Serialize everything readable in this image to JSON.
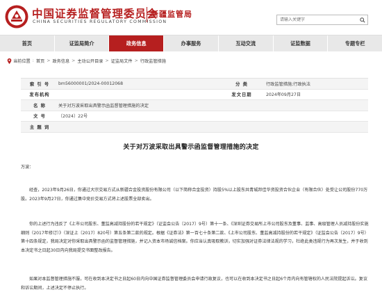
{
  "header": {
    "org_name": "中国证券监督管理委员会",
    "org_name_en": "CHINA SECURITIES REGULATORY COMMISSION",
    "bureau": "新疆监管局",
    "search_placeholder": "请输入关键字",
    "brand_color": "#b61f1f"
  },
  "nav": {
    "items": [
      {
        "label": "首页",
        "active": false
      },
      {
        "label": "证监局简介",
        "active": false
      },
      {
        "label": "政务信息",
        "active": true
      },
      {
        "label": "办事服务",
        "active": false
      },
      {
        "label": "互动交流",
        "active": false
      },
      {
        "label": "证监数据",
        "active": false
      },
      {
        "label": "专题专栏",
        "active": false
      }
    ]
  },
  "breadcrumb": {
    "items": [
      "当前位置",
      "首页",
      "政务信息",
      "主动公开目录",
      "证监局文件",
      "行政监管措施"
    ]
  },
  "info": {
    "index_label": "索 引 号",
    "index_value": "bm56000001/2024-00012068",
    "category_label": "分 类",
    "category_value": "行政监管措施;行政执法",
    "issuer_label": "发布机构",
    "issuer_value": "",
    "date_label": "发文日期",
    "date_value": "2024年09月27日",
    "name_label": "名 称",
    "name_value": "关于对万波采取出具警示函监督管理措施的决定",
    "doc_no_label": "文 号",
    "doc_no_value": "〔2024〕22号",
    "subject_label": "主 题 词",
    "subject_value": ""
  },
  "article": {
    "title": "关于对万波采取出具警示函监督管理措施的决定",
    "salutation": "万波：",
    "p1": "经查，2023年9月26日，你通过大宗交易方式从新疆合金投资股份有限公司（以下简称合金投资）持股5%以上股东共青城邦佳华资投资合伙企业（有限合伙）处受让公司股份770万股。2023年9月27日，你通过集中竞价交易方式将上述股票全部卖出。",
    "p2": "你的上述行为违反了《上市公司股东、董监高减持股份的若干规定》（证监会公告〔2017〕9号）第十一条、《深圳证券交易所上市公司股东及董事、监事、高级管理人员减持股份实施细则（2017年修订）》（深证上〔2017〕820号）第五条第二款的规定。根据《证券法》第一百七十条第二款、《上市公司股东、董监高减持股份的若干规定》（证监会公告〔2017〕9号）第十四条规定，我局决定对你采取出具警示函的监督管理措施，并记入资本市场诚信档案。你应当认真吸取教训，切实加强对证券法律法规的学习，杜绝此类违规行为再次发生，并于收到本决定书之日起30日内向我局提交书面整改报告。",
    "p3": "如果对本监督管理措施不服，可在收到本决定书之日起60日内向中国证券监督管理委员会申请行政复议，也可以在收到本决定书之日起6个月内向有管辖权的人民法院提起诉讼。复议和诉讼期间，上述决定不停止执行。"
  }
}
